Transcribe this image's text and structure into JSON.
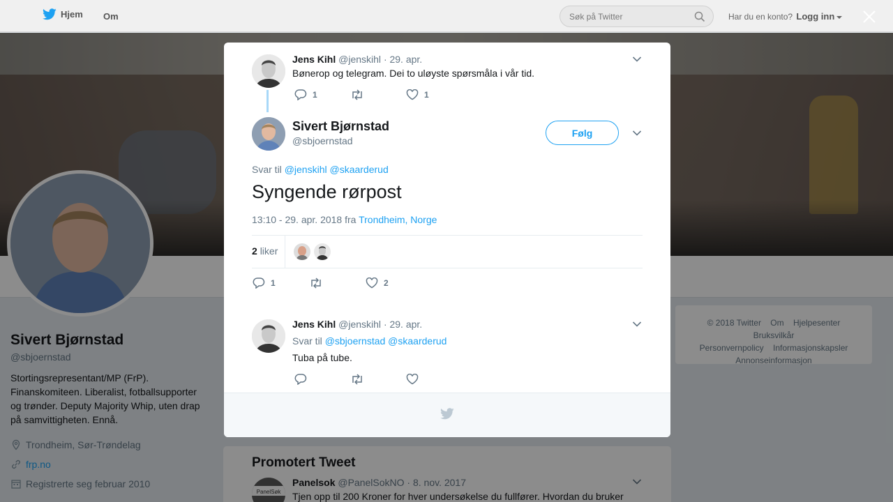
{
  "topbar": {
    "home_label": "Hjem",
    "about_label": "Om",
    "search_placeholder": "Søk på Twitter",
    "account_question": "Har du en konto?",
    "login_label": "Logg inn"
  },
  "profile": {
    "name": "Sivert Bjørnstad",
    "handle": "@sbjoernstad",
    "bio": "Stortingsrepresentant/MP (FrP). Finanskomiteen. Liberalist, fotballsupporter og trønder. Deputy Majority Whip, uten drap på samvittigheten. Ennå.",
    "location": "Trondheim, Sør-Trøndelag",
    "website": "frp.no",
    "joined": "Registrerte seg februar 2010"
  },
  "footer": {
    "copyright": "© 2018 Twitter",
    "links": [
      "Om",
      "Hjelpesenter",
      "Bruksvilkår",
      "Personvernpolicy",
      "Informasjonskapsler",
      "Annonseinformasjon"
    ]
  },
  "modal": {
    "parent_tweet": {
      "name": "Jens Kihl",
      "handle": "@jenskihl",
      "date": "· 29. apr.",
      "text": "Bønerop og telegram. Dei to uløyste spørsmåla i vår tid.",
      "replies": "1",
      "likes": "1"
    },
    "main_tweet": {
      "name": "Sivert Bjørnstad",
      "handle": "@sbjoernstad",
      "follow_label": "Følg",
      "reply_prefix": "Svar til",
      "reply_mentions": [
        "@jenskihl",
        "@skaarderud"
      ],
      "text": "Syngende rørpost",
      "timestamp": "13:10 - 29. apr. 2018 fra",
      "place": "Trondheim, Norge",
      "likes_count": "2",
      "likes_label": "liker",
      "replies": "1",
      "hearts": "2"
    },
    "reply_tweet": {
      "name": "Jens Kihl",
      "handle": "@jenskihl",
      "date": "· 29. apr.",
      "reply_prefix": "Svar til",
      "reply_mentions": [
        "@sbjoernstad",
        "@skaarderud"
      ],
      "text": "Tuba på tube."
    }
  },
  "promoted": {
    "title": "Promotert Tweet",
    "name": "Panelsok",
    "handle": "@PanelSokNO",
    "date": "· 8. nov. 2017",
    "text": "Tjen opp til 200 Kroner for hver undersøkelse du fullfører. Hvordan du bruker",
    "avatar_text": "PanelSøk"
  },
  "colors": {
    "accent": "#1da1f2",
    "secondary_text": "#657786"
  }
}
